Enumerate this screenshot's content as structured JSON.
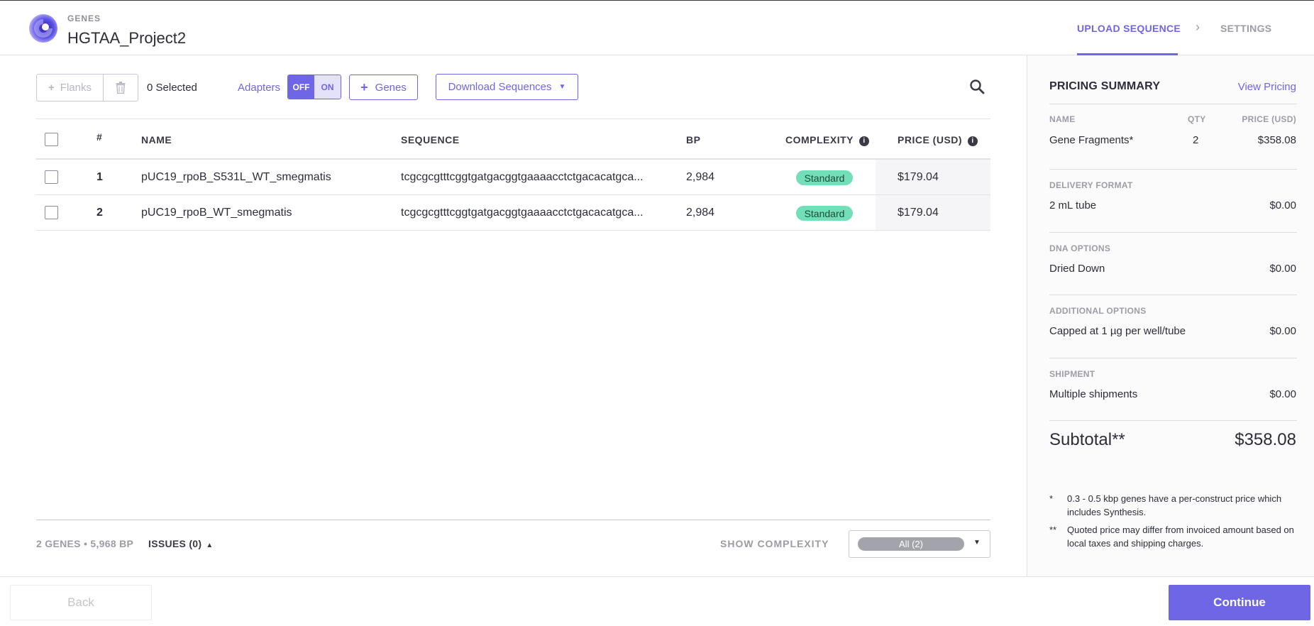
{
  "header": {
    "brand": "GENES",
    "project_title": "HGTAA_Project2",
    "steps": [
      {
        "label": "UPLOAD SEQUENCE",
        "active": true
      },
      {
        "label": "SETTINGS",
        "active": false
      }
    ],
    "chevron": "›"
  },
  "toolbar": {
    "flanks_label": "Flanks",
    "selected_text": "0 Selected",
    "adapters_label": "Adapters",
    "toggle_off": "OFF",
    "toggle_on": "ON",
    "genes_label": "Genes",
    "download_label": "Download Sequences"
  },
  "table": {
    "headers": {
      "num": "#",
      "name": "NAME",
      "sequence": "SEQUENCE",
      "bp": "BP",
      "complexity": "COMPLEXITY",
      "price": "PRICE (USD)"
    },
    "rows": [
      {
        "num": "1",
        "name": "pUC19_rpoB_S531L_WT_smegmatis",
        "sequence": "tcgcgcgtttcggtgatgacggtgaaaacctctgacacatgca...",
        "bp": "2,984",
        "complexity": "Standard",
        "price": "$179.04"
      },
      {
        "num": "2",
        "name": "pUC19_rpoB_WT_smegmatis",
        "sequence": "tcgcgcgtttcggtgatgacggtgaaaacctctgacacatgca...",
        "bp": "2,984",
        "complexity": "Standard",
        "price": "$179.04"
      }
    ]
  },
  "footer": {
    "genes_summary": "2 GENES • 5,968 BP",
    "issues": "ISSUES (0)",
    "show_complexity": "SHOW COMPLEXITY",
    "complexity_filter": "All (2)"
  },
  "pricing": {
    "title": "PRICING SUMMARY",
    "view_pricing": "View Pricing",
    "col_name": "NAME",
    "col_qty": "QTY",
    "col_price": "PRICE (USD)",
    "item_name": "Gene Fragments*",
    "item_qty": "2",
    "item_price": "$358.08",
    "delivery_label": "DELIVERY FORMAT",
    "delivery_value": "2 mL tube",
    "delivery_price": "$0.00",
    "dna_label": "DNA OPTIONS",
    "dna_value": "Dried Down",
    "dna_price": "$0.00",
    "additional_label": "ADDITIONAL OPTIONS",
    "additional_value": "Capped at 1 µg per well/tube",
    "additional_price": "$0.00",
    "shipment_label": "SHIPMENT",
    "shipment_value": "Multiple shipments",
    "shipment_price": "$0.00",
    "subtotal_label": "Subtotal**",
    "subtotal_value": "$358.08",
    "note1_mark": "*",
    "note1": "0.3 - 0.5 kbp genes have a per-construct price which includes Synthesis.",
    "note2_mark": "**",
    "note2": "Quoted price may differ from invoiced amount based on local taxes and shipping charges."
  },
  "nav": {
    "back": "Back",
    "continue": "Continue"
  },
  "colors": {
    "accent": "#6f66e6",
    "badge_standard": "#72dfb9"
  },
  "icons": [
    "logo-icon",
    "plus-icon",
    "trash-icon",
    "caret-down-icon",
    "search-icon",
    "info-icon",
    "caret-up-icon",
    "chevron-right-icon"
  ]
}
